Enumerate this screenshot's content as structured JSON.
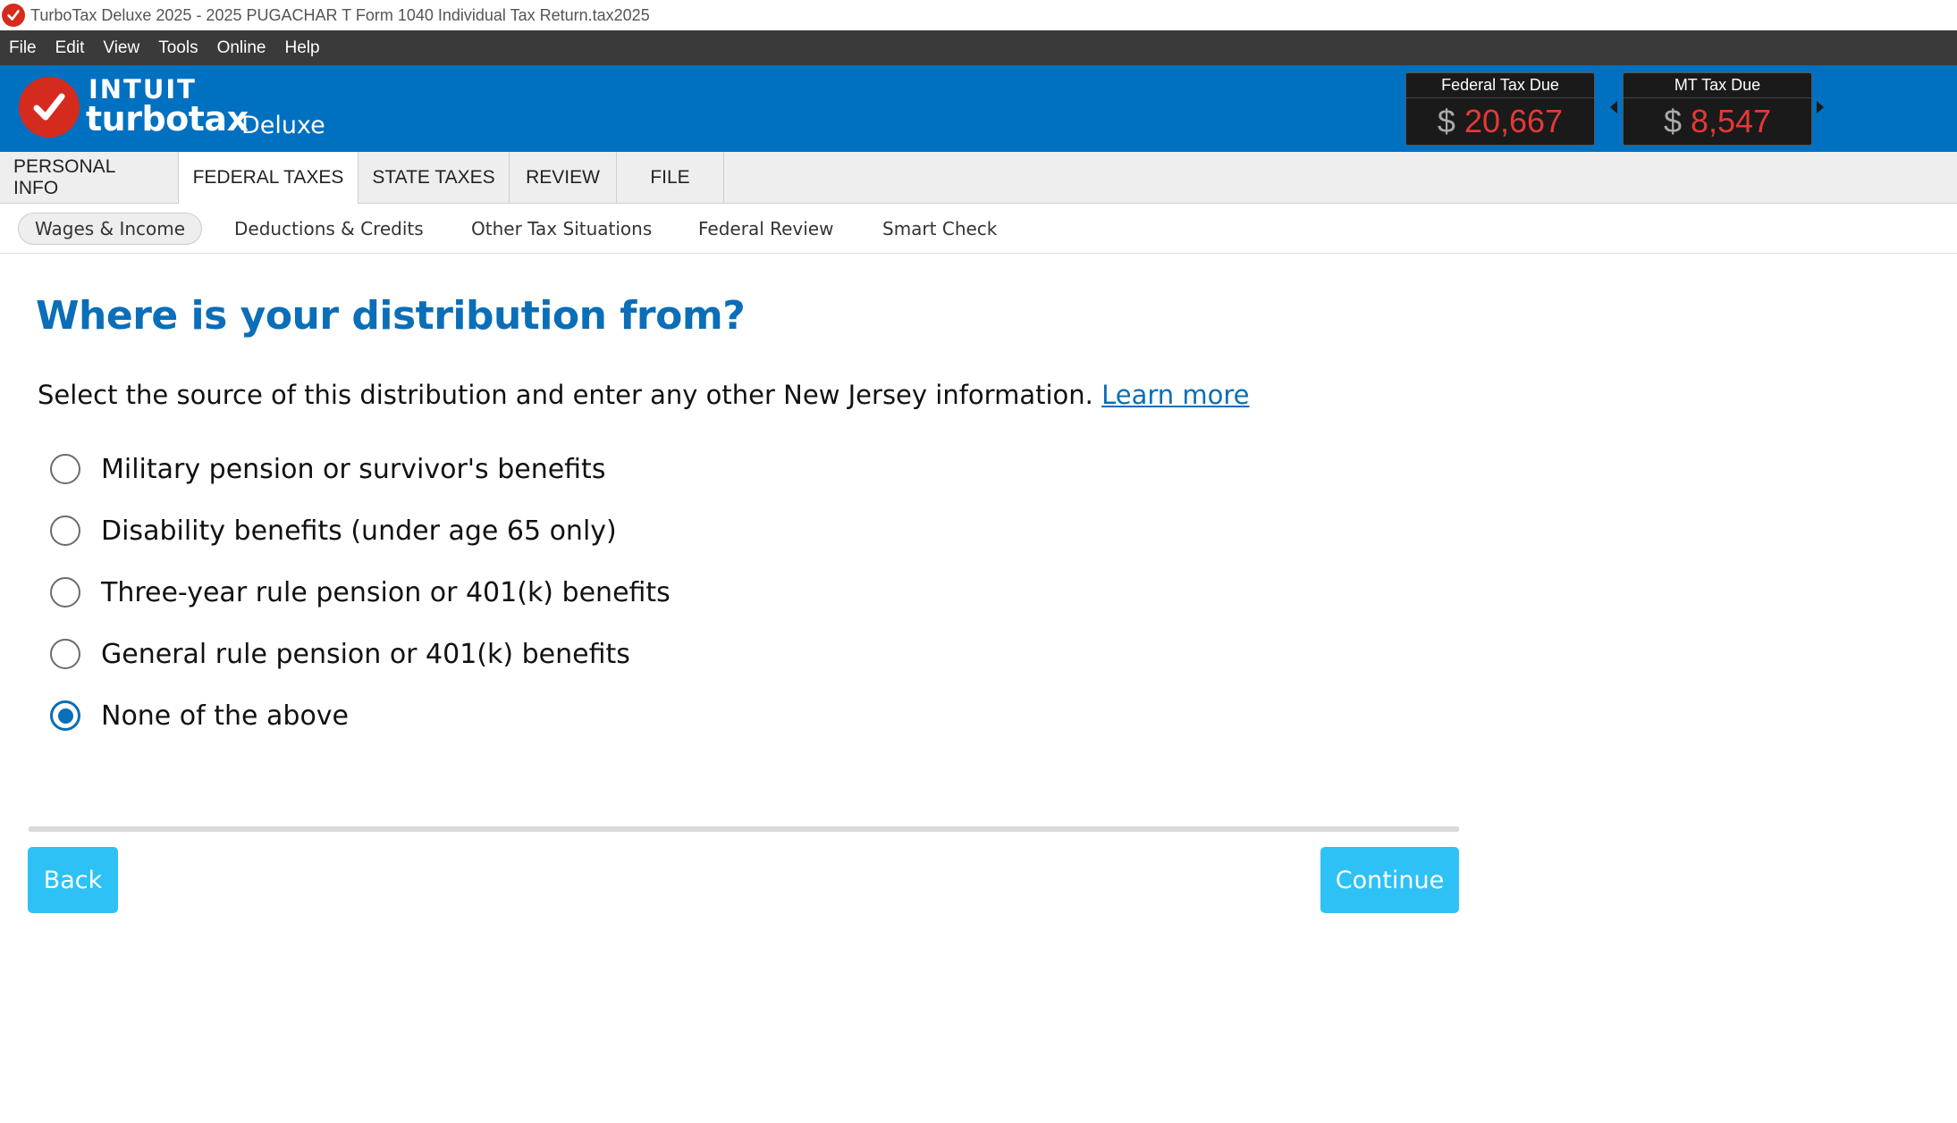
{
  "window": {
    "title": "TurboTax Deluxe 2025 - 2025 PUGACHAR T Form 1040  Individual Tax Return.tax2025"
  },
  "menu": [
    "File",
    "Edit",
    "View",
    "Tools",
    "Online",
    "Help"
  ],
  "brand": {
    "company": "INTUIT",
    "product": "turbotax",
    "edition": "Deluxe"
  },
  "tax_due": {
    "federal": {
      "label": "Federal Tax Due",
      "currency": "$",
      "amount": "20,667"
    },
    "state": {
      "label": "MT Tax Due",
      "currency": "$",
      "amount": "8,547"
    }
  },
  "main_tabs": [
    {
      "label": "PERSONAL INFO",
      "active": false
    },
    {
      "label": "FEDERAL TAXES",
      "active": true
    },
    {
      "label": "STATE TAXES",
      "active": false
    },
    {
      "label": "REVIEW",
      "active": false
    },
    {
      "label": "FILE",
      "active": false
    }
  ],
  "sub_tabs": [
    {
      "label": "Wages & Income",
      "active": true
    },
    {
      "label": "Deductions & Credits",
      "active": false
    },
    {
      "label": "Other Tax Situations",
      "active": false
    },
    {
      "label": "Federal Review",
      "active": false
    },
    {
      "label": "Smart Check",
      "active": false
    }
  ],
  "page": {
    "heading": "Where is your distribution from?",
    "instructions": "Select the source of this distribution and enter any other New Jersey information.",
    "learn_more": "Learn more",
    "options": [
      {
        "label": "Military pension or survivor's benefits",
        "selected": false
      },
      {
        "label": "Disability benefits (under age 65 only)",
        "selected": false
      },
      {
        "label": "Three-year rule pension or 401(k) benefits",
        "selected": false
      },
      {
        "label": "General rule pension or 401(k) benefits",
        "selected": false
      },
      {
        "label": "None of the above",
        "selected": true
      }
    ]
  },
  "buttons": {
    "back": "Back",
    "continue": "Continue"
  },
  "colors": {
    "brand_blue": "#0070c0",
    "heading_blue": "#0a6eb8",
    "button_cyan": "#2ec1f5",
    "tax_red": "#e53935",
    "logo_red": "#d52b1e"
  }
}
